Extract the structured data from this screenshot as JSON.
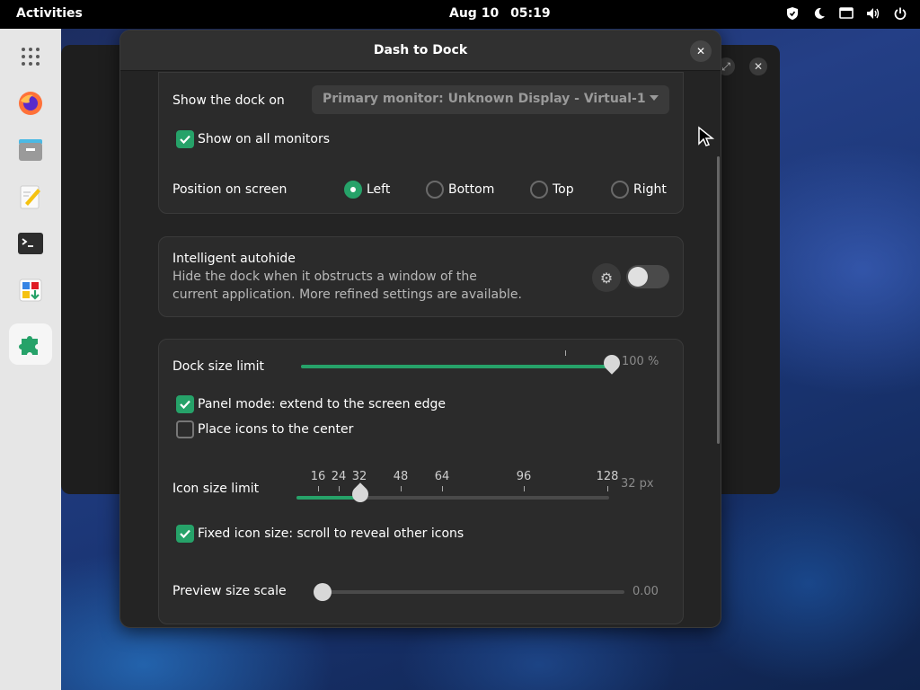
{
  "topbar": {
    "activities": "Activities",
    "date": "Aug 10",
    "time": "05:19",
    "tray_icons": [
      "shield-icon",
      "night-light-icon",
      "display-icon",
      "volume-icon",
      "power-icon"
    ]
  },
  "dock": {
    "items": [
      {
        "name": "app-grid",
        "icon": "app-grid-icon"
      },
      {
        "name": "firefox",
        "icon": "firefox-icon"
      },
      {
        "name": "files",
        "icon": "files-icon"
      },
      {
        "name": "text-editor",
        "icon": "text-editor-icon"
      },
      {
        "name": "terminal",
        "icon": "terminal-icon"
      },
      {
        "name": "software",
        "icon": "software-icon"
      },
      {
        "name": "extensions",
        "icon": "puzzle-icon",
        "active": true
      }
    ]
  },
  "dialog": {
    "title": "Dash to Dock",
    "close_label": "✕"
  },
  "monitor_group": {
    "show_dock_on_label": "Show the dock on",
    "monitor_selected": "Primary monitor: Unknown Display - Virtual-1",
    "all_monitors_label": "Show on all monitors",
    "all_monitors_checked": true,
    "position_label": "Position on screen",
    "positions": [
      {
        "label": "Left",
        "selected": true
      },
      {
        "label": "Bottom",
        "selected": false
      },
      {
        "label": "Top",
        "selected": false
      },
      {
        "label": "Right",
        "selected": false
      }
    ]
  },
  "autohide_group": {
    "title": "Intelligent autohide",
    "description_line1": "Hide the dock when it obstructs a window of the",
    "description_line2": "current application. More refined settings are available.",
    "enabled": false
  },
  "size_group": {
    "dock_size_label": "Dock size limit",
    "dock_size_value": "100 %",
    "dock_size_fraction": 1.0,
    "panel_mode_label": "Panel mode: extend to the screen edge",
    "panel_mode_checked": true,
    "center_icons_label": "Place icons to the center",
    "center_icons_checked": false,
    "icon_size_label": "Icon size limit",
    "icon_size_value": "32 px",
    "icon_size_marks": [
      "16",
      "24",
      "32",
      "48",
      "64",
      "96",
      "128"
    ],
    "fixed_icon_label": "Fixed icon size: scroll to reveal other icons",
    "fixed_icon_checked": true,
    "preview_label": "Preview size scale",
    "preview_value": "0.00"
  },
  "colors": {
    "accent": "#26a269",
    "dialog_bg": "#242424",
    "group_bg": "#2b2b2b"
  }
}
